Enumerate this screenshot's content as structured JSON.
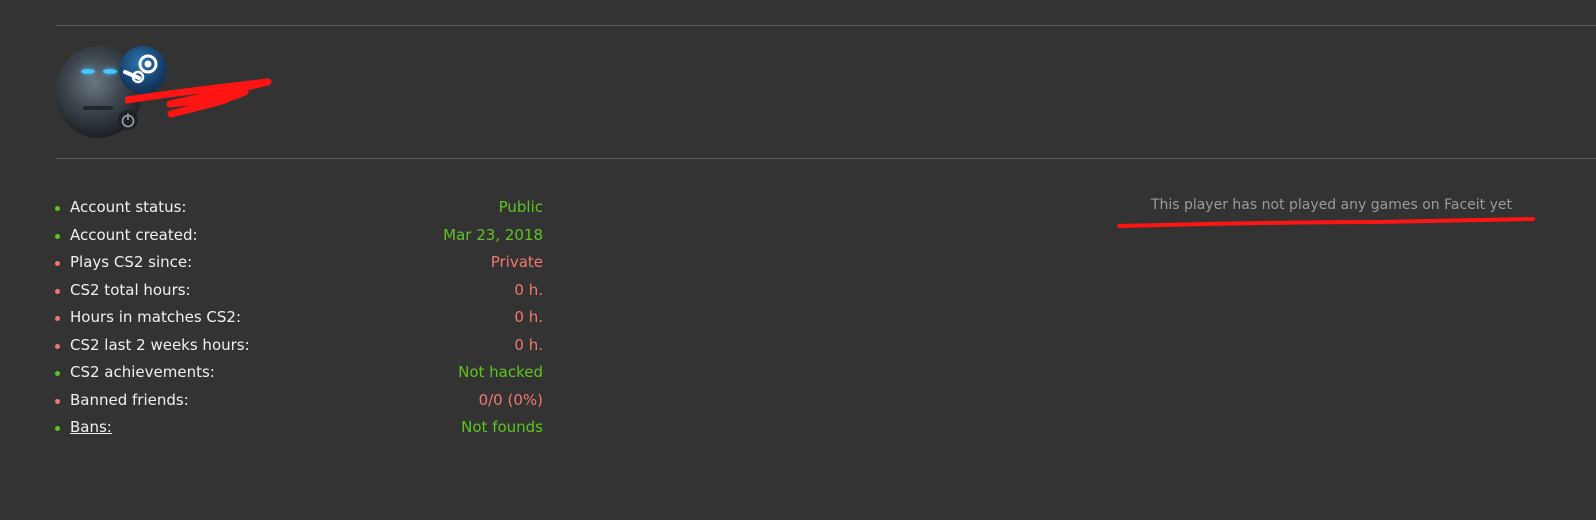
{
  "colors": {
    "background": "#333333",
    "divider": "#5a5a5a",
    "good": "#5ec421",
    "bad": "#f07772",
    "label": "#f0f0f0",
    "muted": "#9a9a9a",
    "annotation": "#ff1a1a"
  },
  "profile": {
    "avatar_icon": "player-avatar",
    "steam_icon": "steam-icon",
    "platform_icon": "power-icon"
  },
  "stats": [
    {
      "label": "Account status:",
      "value": "Public",
      "status": "good"
    },
    {
      "label": "Account created:",
      "value": "Mar 23, 2018",
      "status": "good"
    },
    {
      "label": "Plays CS2 since:",
      "value": "Private",
      "status": "bad"
    },
    {
      "label": "CS2 total hours:",
      "value": "0 h.",
      "status": "bad"
    },
    {
      "label": "Hours in matches CS2:",
      "value": "0 h.",
      "status": "bad"
    },
    {
      "label": "CS2 last 2 weeks hours:",
      "value": "0 h.",
      "status": "bad"
    },
    {
      "label": "CS2 achievements:",
      "value": "Not hacked",
      "status": "good"
    },
    {
      "label": "Banned friends:",
      "value": "0/0 (0%)",
      "status": "bad"
    },
    {
      "label": "Bans:",
      "value": "Not founds",
      "status": "good",
      "link": true
    }
  ],
  "faceit": {
    "message": "This player has not played any games on Faceit yet"
  }
}
